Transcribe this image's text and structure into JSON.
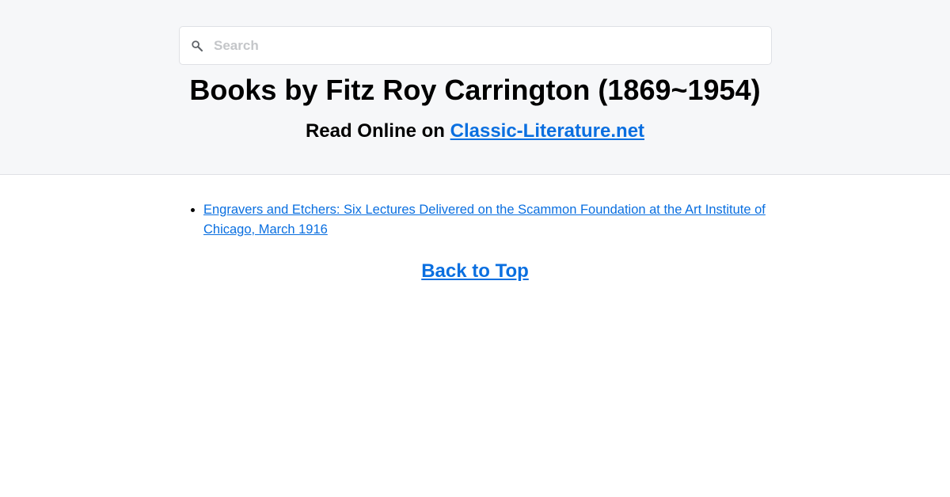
{
  "search": {
    "placeholder": "Search",
    "icon": "search-icon"
  },
  "header": {
    "title": "Books by Fitz Roy Carrington (1869~1954)",
    "subtitle_prefix": "Read Online on",
    "site_link_label": "Classic-Literature.net"
  },
  "books": [
    {
      "title": "Engravers and Etchers: Six Lectures Delivered on the Scammon Foundation at the Art Institute of Chicago, March 1916"
    }
  ],
  "footer": {
    "back_to_top_label": "Back to Top"
  },
  "colors": {
    "header_bg": "#f6f7f9",
    "link": "#0a6fe0",
    "placeholder": "#c4c6c9"
  }
}
